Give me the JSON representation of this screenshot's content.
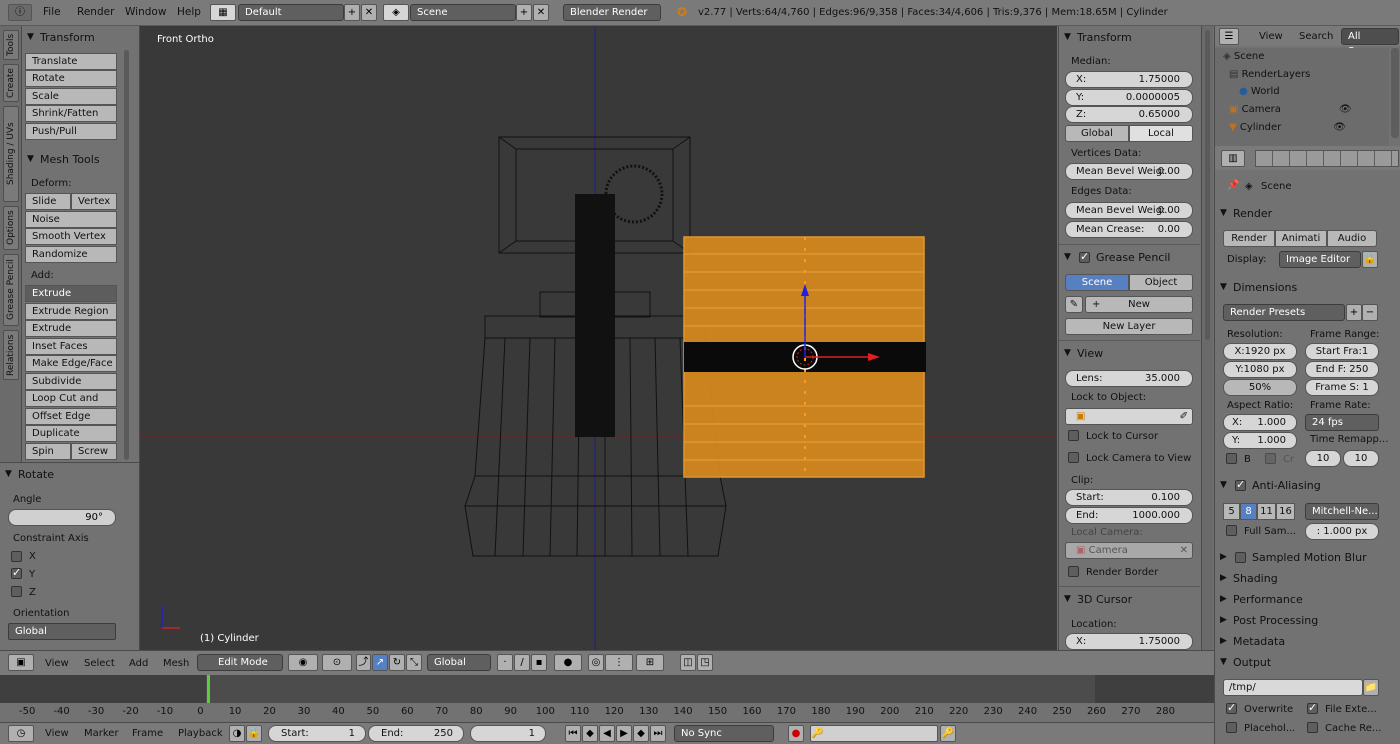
{
  "topbar": {
    "menus": [
      "File",
      "Render",
      "Window",
      "Help"
    ],
    "layout": "Default",
    "scene": "Scene",
    "engine": "Blender Render",
    "stats": "v2.77 | Verts:64/4,760 | Edges:96/9,358 | Faces:34/4,606 | Tris:9,376 | Mem:18.65M | Cylinder"
  },
  "tabs": [
    "Tools",
    "Create",
    "Shading / UVs",
    "Options",
    "Grease Pencil",
    "Relations"
  ],
  "toolshelf": {
    "transform": {
      "title": "Transform",
      "buttons": [
        "Translate",
        "Rotate",
        "Scale",
        "Shrink/Fatten",
        "Push/Pull"
      ]
    },
    "meshtools": {
      "title": "Mesh Tools",
      "deform_label": "Deform:",
      "slide_edge": "Slide Ed",
      "vertex": "Vertex",
      "noise": "Noise",
      "smooth": "Smooth Vertex",
      "randomize": "Randomize",
      "add_label": "Add:",
      "extrude": "Extrude",
      "extrude_region": "Extrude Region",
      "extrude_individual": "Extrude Individual",
      "inset": "Inset Faces",
      "make_edge": "Make Edge/Face",
      "subdivide": "Subdivide",
      "loopcut": "Loop Cut and Slide",
      "offset": "Offset Edge Slide",
      "duplicate": "Duplicate",
      "spin": "Spin",
      "screw": "Screw"
    },
    "operator": {
      "title": "Rotate",
      "angle_label": "Angle",
      "angle": "90°",
      "constraint_label": "Constraint Axis",
      "x": "X",
      "y": "Y",
      "z": "Z",
      "orientation_label": "Orientation",
      "orientation": "Global"
    }
  },
  "viewport": {
    "view_name": "Front Ortho",
    "object_name": "(1) Cylinder"
  },
  "npanel": {
    "transform_title": "Transform",
    "median_label": "Median:",
    "x_label": "X:",
    "x": "1.75000",
    "y_label": "Y:",
    "y": "0.0000005",
    "z_label": "Z:",
    "z": "0.65000",
    "global": "Global",
    "local": "Local",
    "vertices_label": "Vertices Data:",
    "mean_bevel_label": "Mean Bevel Weig:",
    "mean_bevel": "0.00",
    "edges_label": "Edges Data:",
    "mean_bevel2": "0.00",
    "mean_crease_label": "Mean Crease:",
    "mean_crease": "0.00",
    "grease_title": "Grease Pencil",
    "scene_btn": "Scene",
    "object_btn": "Object",
    "new_btn": "New",
    "new_layer": "New Layer",
    "view_title": "View",
    "lens_label": "Lens:",
    "lens": "35.000",
    "lock_object_label": "Lock to Object:",
    "lock_cursor": "Lock to Cursor",
    "lock_camera": "Lock Camera to View",
    "clip_label": "Clip:",
    "start_label": "Start:",
    "start": "0.100",
    "end_label": "End:",
    "end": "1000.000",
    "local_camera_label": "Local Camera:",
    "camera": "Camera",
    "render_border": "Render Border",
    "cursor_title": "3D Cursor",
    "location_label": "Location:",
    "cx_label": "X:",
    "cx": "1.75000"
  },
  "outliner": {
    "view": "View",
    "search": "Search",
    "filter": "All Scenes",
    "items": [
      "Scene",
      "RenderLayers",
      "World",
      "Camera",
      "Cylinder"
    ]
  },
  "properties": {
    "scene": "Scene",
    "render_title": "Render",
    "render_btn": "Render",
    "anim_btn": "Animati",
    "audio_btn": "Audio",
    "display_label": "Display:",
    "display": "Image Editor",
    "dimensions_title": "Dimensions",
    "presets": "Render Presets",
    "resolution_label": "Resolution:",
    "res_x": "X:1920 px",
    "res_y": "Y:1080 px",
    "res_pct": "50%",
    "frame_range_label": "Frame Range:",
    "start_frame": "Start Fra:1",
    "end_frame": "End F: 250",
    "frame_step": "Frame S: 1",
    "aspect_label": "Aspect Ratio:",
    "asp_x": "X:",
    "asp_x_v": "1.000",
    "asp_y": "Y:",
    "asp_y_v": "1.000",
    "framerate_label": "Frame Rate:",
    "fps": "24 fps",
    "remap_label": "Time Remapp...",
    "remap_old": "10",
    "remap_new": "10",
    "b": "B",
    "cr": "Cr",
    "aa_title": "Anti-Aliasing",
    "aa_samples": [
      "5",
      "8",
      "11",
      "16"
    ],
    "filter": "Mitchell-Ne...",
    "full_sample": "Full Sam...",
    "filter_size": ": 1.000 px",
    "motion_blur": "Sampled Motion Blur",
    "shading": "Shading",
    "performance": "Performance",
    "post": "Post Processing",
    "metadata": "Metadata",
    "output": "Output",
    "path": "/tmp/",
    "overwrite": "Overwrite",
    "file_ext": "File Exte...",
    "placeholders": "Placehol...",
    "cache": "Cache Re..."
  },
  "header3d": {
    "view": "View",
    "select": "Select",
    "add": "Add",
    "mesh": "Mesh",
    "mode": "Edit Mode",
    "orientation": "Global"
  },
  "timeline": {
    "ticks": [
      "-50",
      "-40",
      "-30",
      "-20",
      "-10",
      "0",
      "10",
      "20",
      "30",
      "40",
      "50",
      "60",
      "70",
      "80",
      "90",
      "100",
      "110",
      "120",
      "130",
      "140",
      "150",
      "160",
      "170",
      "180",
      "190",
      "200",
      "210",
      "220",
      "230",
      "240",
      "250",
      "260",
      "270",
      "280"
    ]
  },
  "tlheader": {
    "view": "View",
    "marker": "Marker",
    "frame": "Frame",
    "playback": "Playback",
    "start_label": "Start:",
    "start": "1",
    "end_label": "End:",
    "end": "250",
    "current": "1",
    "sync": "No Sync"
  }
}
